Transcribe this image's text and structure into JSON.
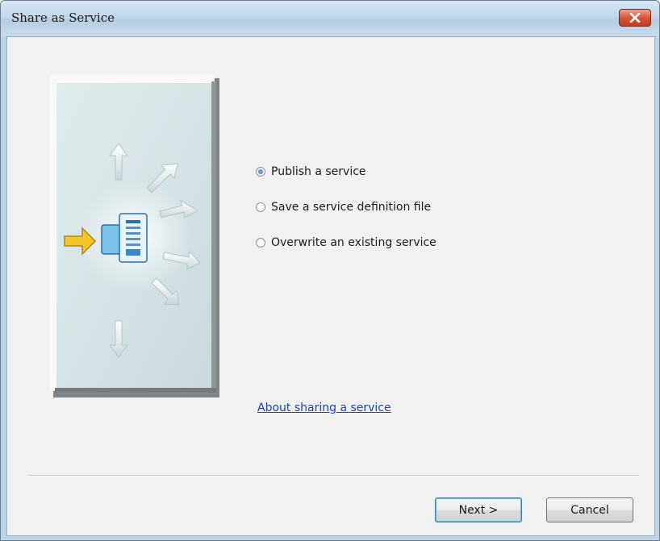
{
  "window": {
    "title": "Share as Service"
  },
  "options": [
    {
      "label": "Publish a service",
      "checked": true
    },
    {
      "label": "Save a service definition file",
      "checked": false
    },
    {
      "label": "Overwrite an existing service",
      "checked": false
    }
  ],
  "help_link": "About sharing a service",
  "buttons": {
    "next": "Next >",
    "cancel": "Cancel"
  },
  "icons": {
    "close": "close-icon",
    "illustration": "share-service-icon",
    "arrow": "arrow-right-icon"
  },
  "colors": {
    "panel": "#d4e3e6",
    "arrow_yellow": "#f2c62a",
    "link": "#1c44b8",
    "close_red": "#d8553a"
  }
}
